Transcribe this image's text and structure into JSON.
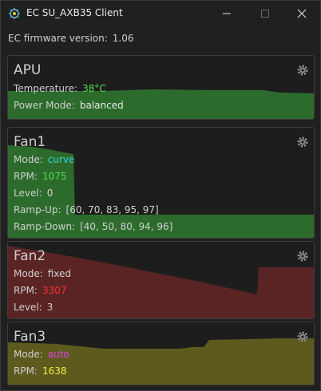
{
  "window": {
    "title": "EC SU_AXB35 Client",
    "icon": "chip-icon",
    "controls": {
      "minimize": "minimize-icon",
      "maximize": "maximize-icon",
      "close": "close-icon"
    }
  },
  "firmware": {
    "label": "EC firmware version:",
    "value": "1.06"
  },
  "apu": {
    "title": "APU",
    "temperature_label": "Temperature:",
    "temperature_value": "38°C",
    "temperature_color": "#4ee04e",
    "power_mode_label": "Power Mode:",
    "power_mode_value": "balanced",
    "graph_color": "#2d6b2d"
  },
  "fan1": {
    "title": "Fan1",
    "mode_label": "Mode:",
    "mode_value": "curve",
    "mode_color": "#2fd7d7",
    "rpm_label": "RPM:",
    "rpm_value": "1075",
    "rpm_color": "#4ee04e",
    "level_label": "Level:",
    "level_value": "0",
    "rampup_label": "Ramp-Up:",
    "rampup_value": "[60, 70, 83, 95, 97]",
    "rampdown_label": "Ramp-Down:",
    "rampdown_value": "[40, 50, 80, 94, 96]",
    "graph_color": "#2d6b2d"
  },
  "fan2": {
    "title": "Fan2",
    "mode_label": "Mode:",
    "mode_value": "fixed",
    "rpm_label": "RPM:",
    "rpm_value": "3307",
    "rpm_color": "#ff3030",
    "level_label": "Level:",
    "level_value": "3",
    "graph_color": "#5a2424"
  },
  "fan3": {
    "title": "Fan3",
    "mode_label": "Mode:",
    "mode_value": "auto",
    "mode_color": "#e040e0",
    "rpm_label": "RPM:",
    "rpm_value": "1638",
    "rpm_color": "#f0f040",
    "graph_color": "#5d5a1e"
  }
}
